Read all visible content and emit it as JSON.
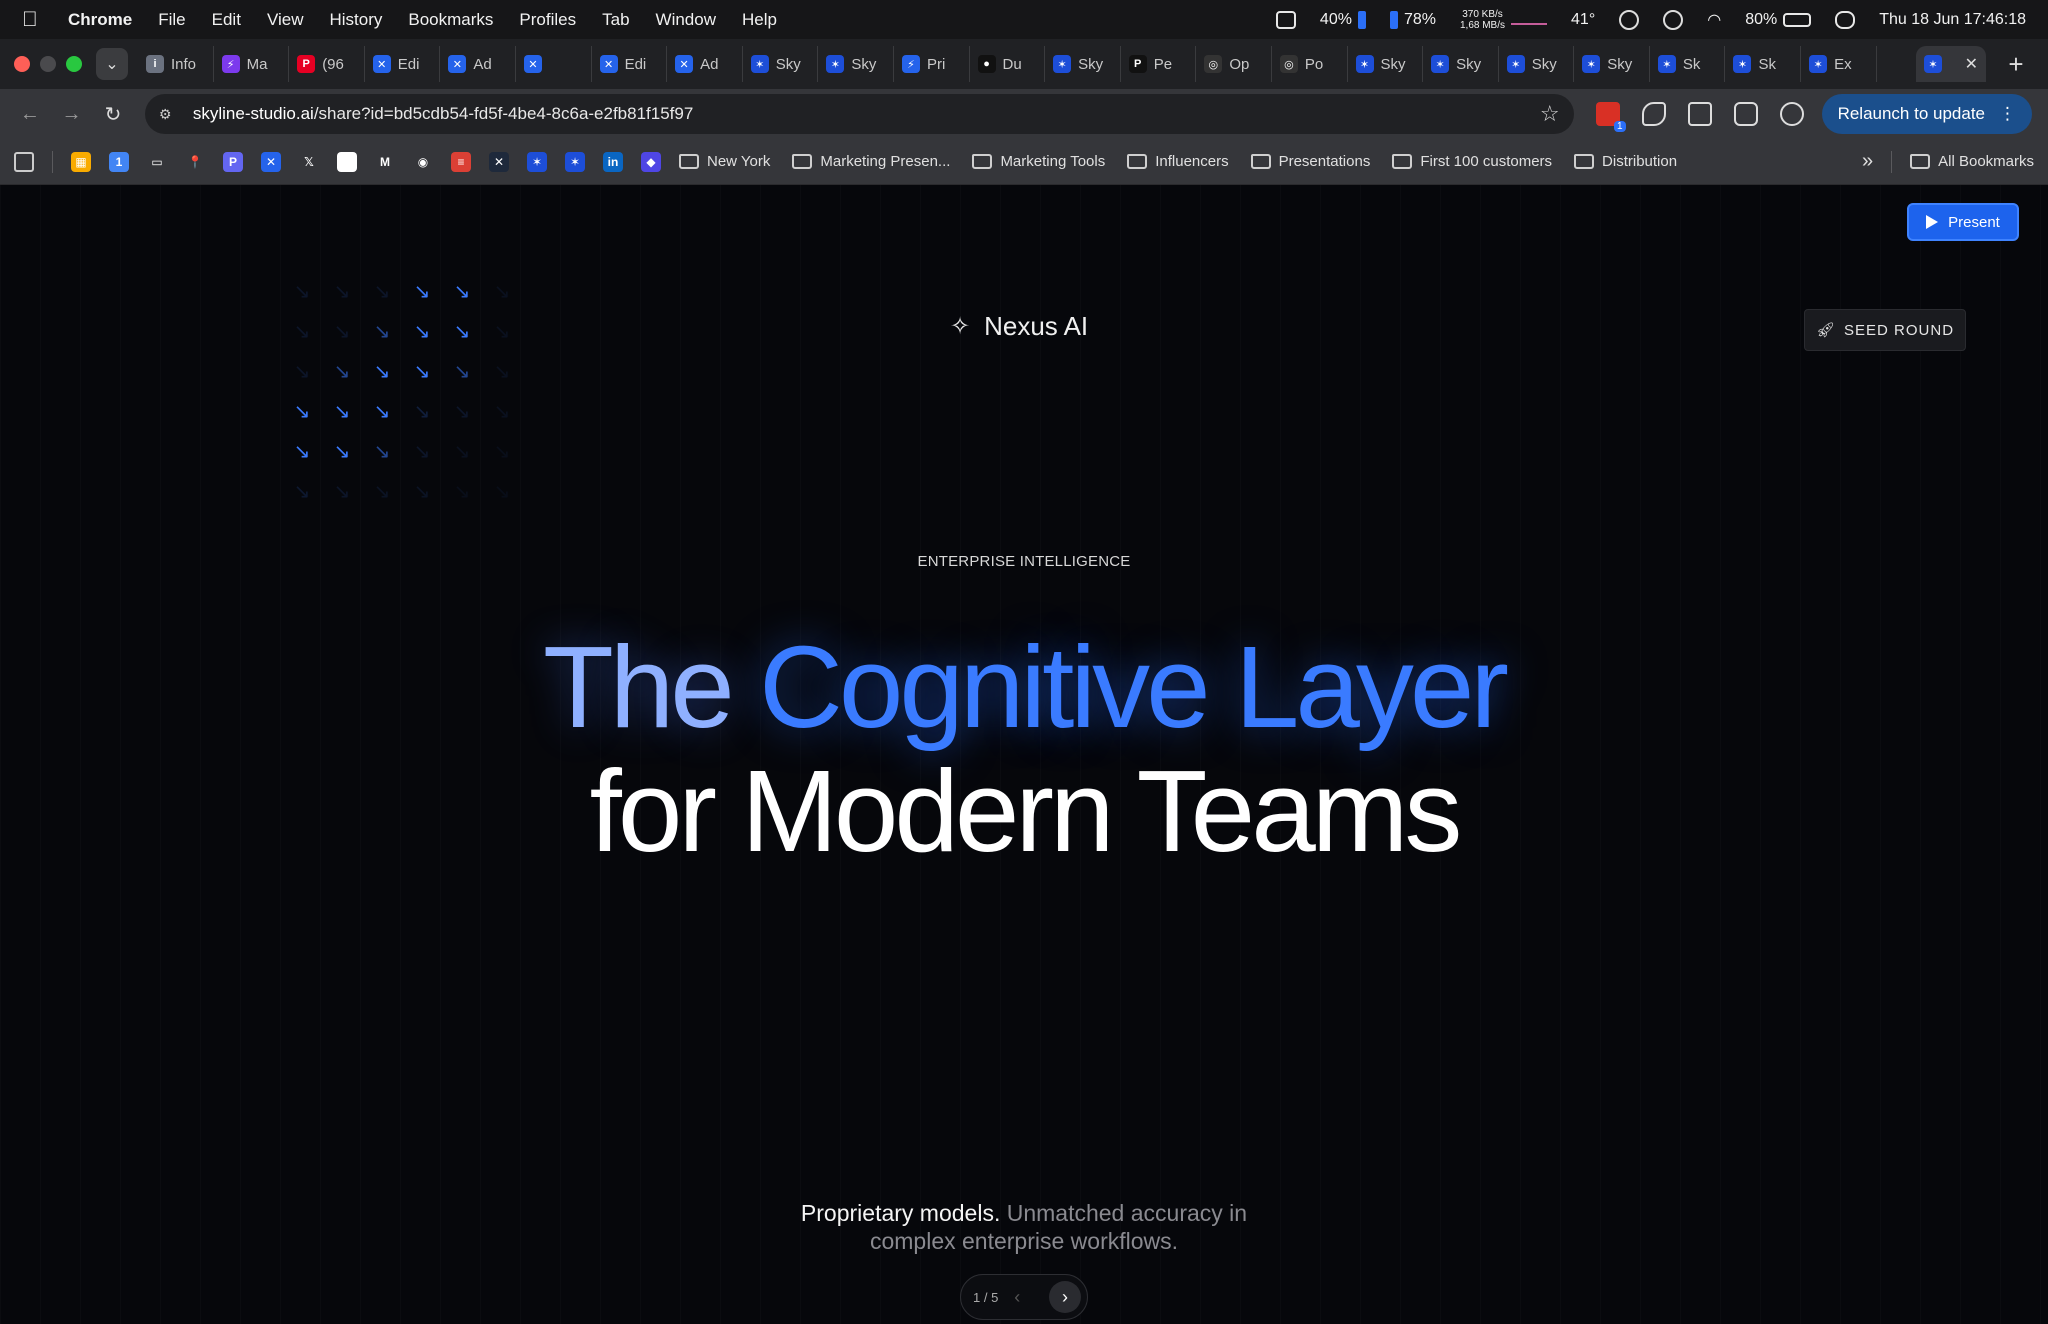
{
  "menubar": {
    "apple_glyph": "",
    "items": [
      "Chrome",
      "File",
      "Edit",
      "View",
      "History",
      "Bookmarks",
      "Profiles",
      "Tab",
      "Window",
      "Help"
    ],
    "status": {
      "cpu": "40%",
      "mem": "78%",
      "net_up": "370 KB/s",
      "net_down": "1,68 MB/s",
      "temp": "41°",
      "battery": "80%",
      "datetime": "Thu 18 Jun  17:46:18"
    }
  },
  "tabs": [
    {
      "label": "Info",
      "color": "#6b7280",
      "glyph": "i"
    },
    {
      "label": "Ma",
      "color": "#7c3aed",
      "glyph": "⚡"
    },
    {
      "label": "(96",
      "color": "#e60023",
      "glyph": "P"
    },
    {
      "label": "Edi",
      "color": "#2563eb",
      "glyph": "✕"
    },
    {
      "label": "Ad",
      "color": "#2563eb",
      "glyph": "✕"
    },
    {
      "label": "",
      "color": "#2563eb",
      "glyph": "✕"
    },
    {
      "label": "Edi",
      "color": "#2563eb",
      "glyph": "✕"
    },
    {
      "label": "Ad",
      "color": "#2563eb",
      "glyph": "✕"
    },
    {
      "label": "Sky",
      "color": "#1d4ed8",
      "glyph": "✶"
    },
    {
      "label": "Sky",
      "color": "#1d4ed8",
      "glyph": "✶"
    },
    {
      "label": "Pri",
      "color": "#2563eb",
      "glyph": "⚡"
    },
    {
      "label": "Du",
      "color": "#111111",
      "glyph": "●"
    },
    {
      "label": "Sky",
      "color": "#1d4ed8",
      "glyph": "✶"
    },
    {
      "label": "Pe",
      "color": "#111111",
      "glyph": "P"
    },
    {
      "label": "Op",
      "color": "#333333",
      "glyph": "◎"
    },
    {
      "label": "Po",
      "color": "#333333",
      "glyph": "◎"
    },
    {
      "label": "Sky",
      "color": "#1d4ed8",
      "glyph": "✶"
    },
    {
      "label": "Sky",
      "color": "#1d4ed8",
      "glyph": "✶"
    },
    {
      "label": "Sky",
      "color": "#1d4ed8",
      "glyph": "✶"
    },
    {
      "label": "Sky",
      "color": "#1d4ed8",
      "glyph": "✶"
    },
    {
      "label": "Sk",
      "color": "#1d4ed8",
      "glyph": "✶"
    },
    {
      "label": "Sk",
      "color": "#1d4ed8",
      "glyph": "✶"
    },
    {
      "label": "Ex",
      "color": "#1d4ed8",
      "glyph": "✶"
    }
  ],
  "active_tab": {
    "glyph": "✶",
    "close": "✕"
  },
  "new_tab": "+",
  "address": {
    "host": "skyline-studio.ai",
    "path": "/share?id=bd5cdb54-fd5f-4be4-8c6a-e2fb81f15f97"
  },
  "relaunch": {
    "label": "Relaunch to update",
    "menu": "⋮"
  },
  "bookmarks": {
    "icons": [
      {
        "name": "calendar-icon",
        "color": "#f9ab00",
        "glyph": "▦"
      },
      {
        "name": "docs-icon",
        "color": "#4285f4",
        "glyph": "1"
      },
      {
        "name": "folder-icon",
        "color": "transparent",
        "glyph": "▭"
      },
      {
        "name": "maps-icon",
        "color": "transparent",
        "glyph": "📍"
      },
      {
        "name": "p-icon",
        "color": "#6366f1",
        "glyph": "P"
      },
      {
        "name": "x-blue-icon",
        "color": "#2563eb",
        "glyph": "✕"
      },
      {
        "name": "x-icon",
        "color": "transparent",
        "glyph": "𝕏"
      },
      {
        "name": "c-icon",
        "color": "#ffffff",
        "glyph": "C"
      },
      {
        "name": "gmail-icon",
        "color": "transparent",
        "glyph": "M"
      },
      {
        "name": "github-icon",
        "color": "transparent",
        "glyph": "◉"
      },
      {
        "name": "todoist-icon",
        "color": "#db4035",
        "glyph": "≡"
      },
      {
        "name": "x-dark-icon",
        "color": "#1e293b",
        "glyph": "✕"
      },
      {
        "name": "sky-icon",
        "color": "#1d4ed8",
        "glyph": "✶"
      },
      {
        "name": "sky2-icon",
        "color": "#1d4ed8",
        "glyph": "✶"
      },
      {
        "name": "linkedin-icon",
        "color": "#0a66c2",
        "glyph": "in"
      },
      {
        "name": "app-icon",
        "color": "#4f46e5",
        "glyph": "◆"
      }
    ],
    "folders": [
      "New York",
      "Marketing Presen...",
      "Marketing Tools",
      "Influencers",
      "Presentations",
      "First 100 customers",
      "Distribution"
    ],
    "overflow": "»",
    "all": "All Bookmarks"
  },
  "slide": {
    "present_label": "Present",
    "brand": "Nexus AI",
    "badge": "SEED ROUND",
    "eyebrow": "ENTERPRISE INTELLIGENCE",
    "headline_a": "The",
    "headline_b": "Cognitive Layer",
    "headline_c": "for Modern Teams",
    "sub_em": "Proprietary models.",
    "sub_rest": " Unmatched accuracy in",
    "sub_line2": "complex enterprise workflows.",
    "page": "1 / 5",
    "prev": "‹",
    "next": "›",
    "arrow_glyph": "↘",
    "accent": "#3a7bff",
    "arrow_opacity": [
      [
        0.12,
        0.12,
        0.12,
        1.0,
        1.0,
        0.08
      ],
      [
        0.12,
        0.12,
        0.55,
        1.0,
        1.0,
        0.08
      ],
      [
        0.12,
        0.55,
        1.0,
        1.0,
        0.55,
        0.08
      ],
      [
        1.0,
        1.0,
        1.0,
        0.2,
        0.12,
        0.08
      ],
      [
        1.0,
        1.0,
        0.55,
        0.12,
        0.08,
        0.06
      ],
      [
        0.15,
        0.12,
        0.1,
        0.1,
        0.06,
        0.05
      ]
    ]
  }
}
